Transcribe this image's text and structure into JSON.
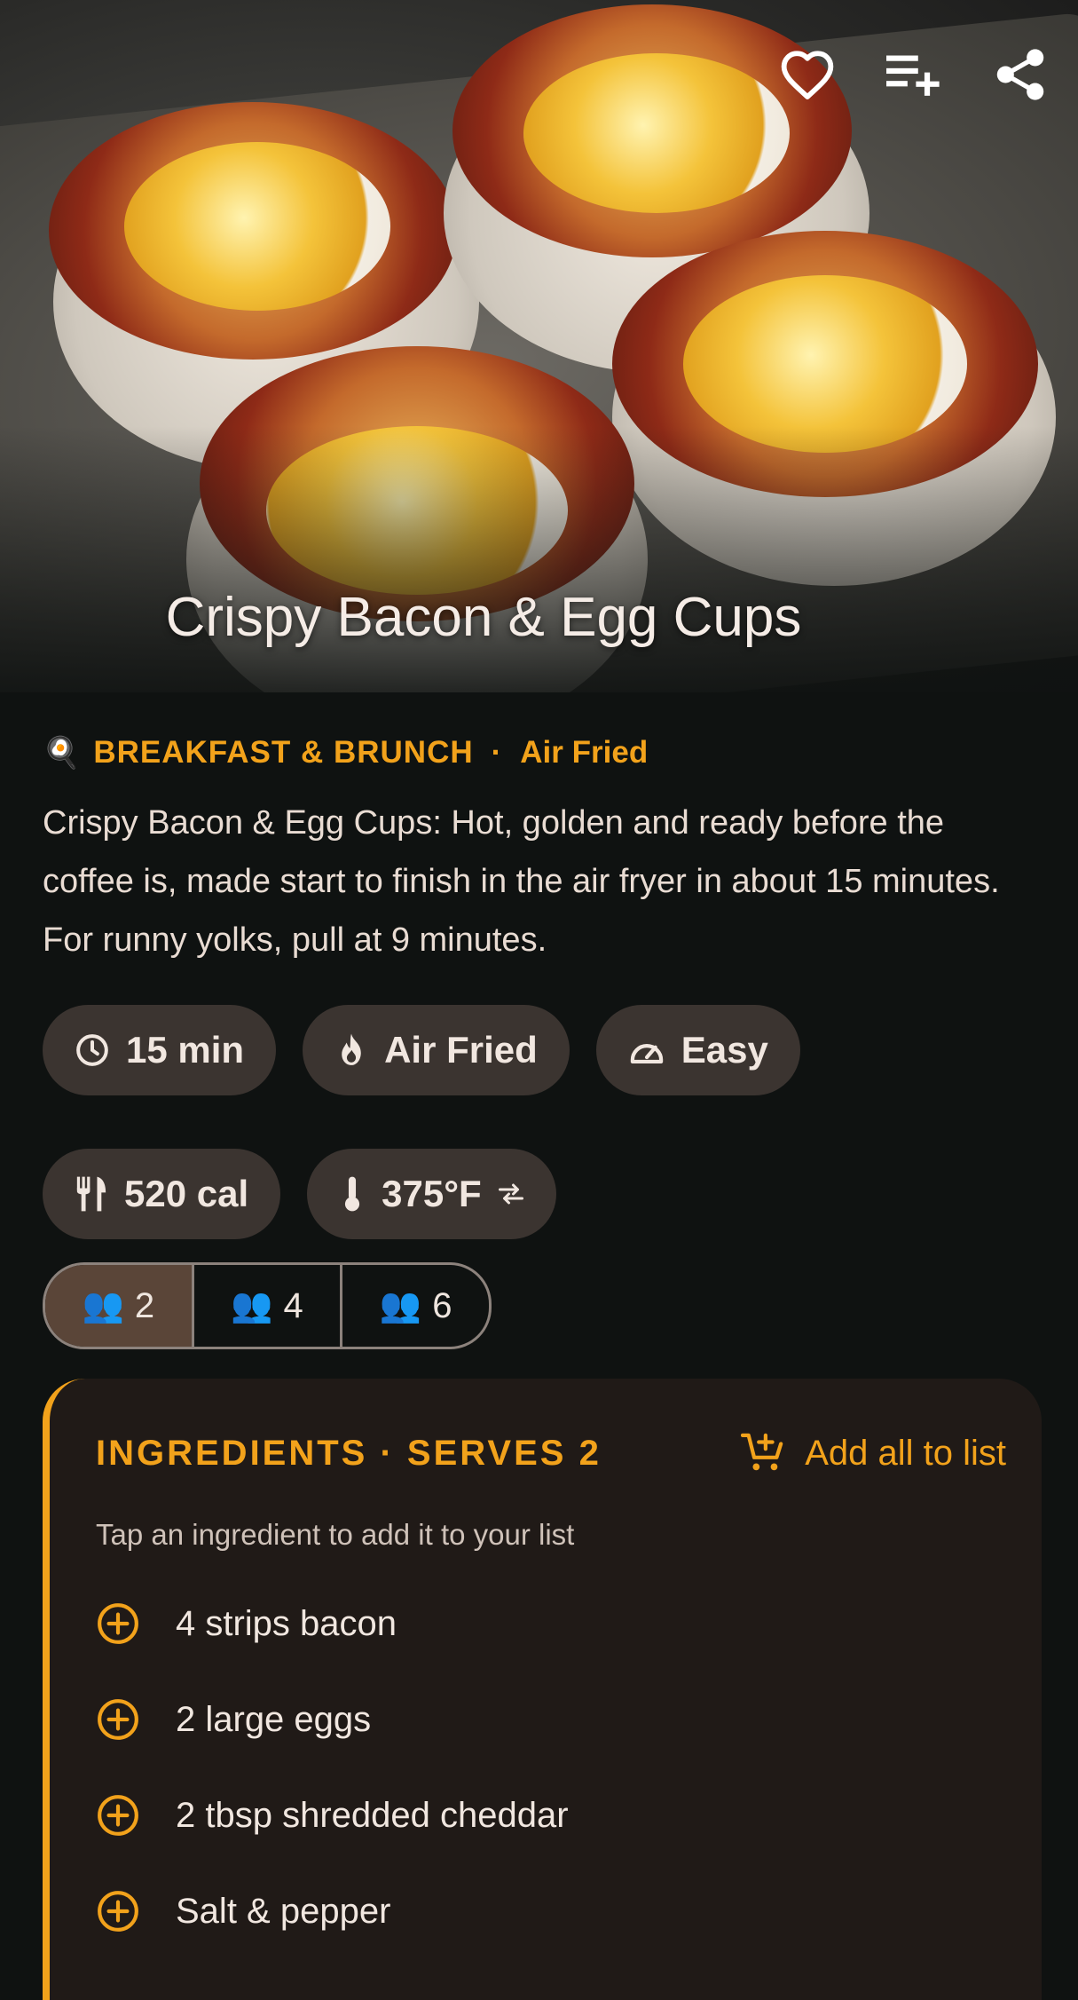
{
  "recipe": {
    "title": "Crispy Bacon & Egg Cups",
    "category_icon": "🍳",
    "category": "BREAKFAST & BRUNCH",
    "category_separator": "·",
    "method": "Air Fried",
    "description": "Crispy Bacon & Egg Cups: Hot, golden and ready before the coffee is, made start to finish in the air fryer in about 15 minutes. For runny yolks, pull at 9 minutes."
  },
  "hero_actions": {
    "favorite_icon": "heart-outline-icon",
    "add_to_playlist_icon": "playlist-add-icon",
    "share_icon": "share-icon"
  },
  "chips": {
    "time": "15 min",
    "method": "Air Fried",
    "difficulty": "Easy",
    "calories": "520 cal",
    "temperature": "375°F"
  },
  "servings": {
    "icon": "👥",
    "options": [
      "2",
      "4",
      "6"
    ],
    "selected": "2"
  },
  "ingredients": {
    "title": "INGREDIENTS · SERVES 2",
    "add_all_label": "Add all to list",
    "hint": "Tap an ingredient to add it to your list",
    "items": [
      "4 strips bacon",
      "2 large eggs",
      "2 tbsp shredded cheddar",
      "Salt & pepper"
    ]
  },
  "colors": {
    "accent": "#f2a21b",
    "background": "#0f1211",
    "chip_bg": "#3b3430",
    "card_bg": "#201a17",
    "segment_active": "#5a4538"
  }
}
